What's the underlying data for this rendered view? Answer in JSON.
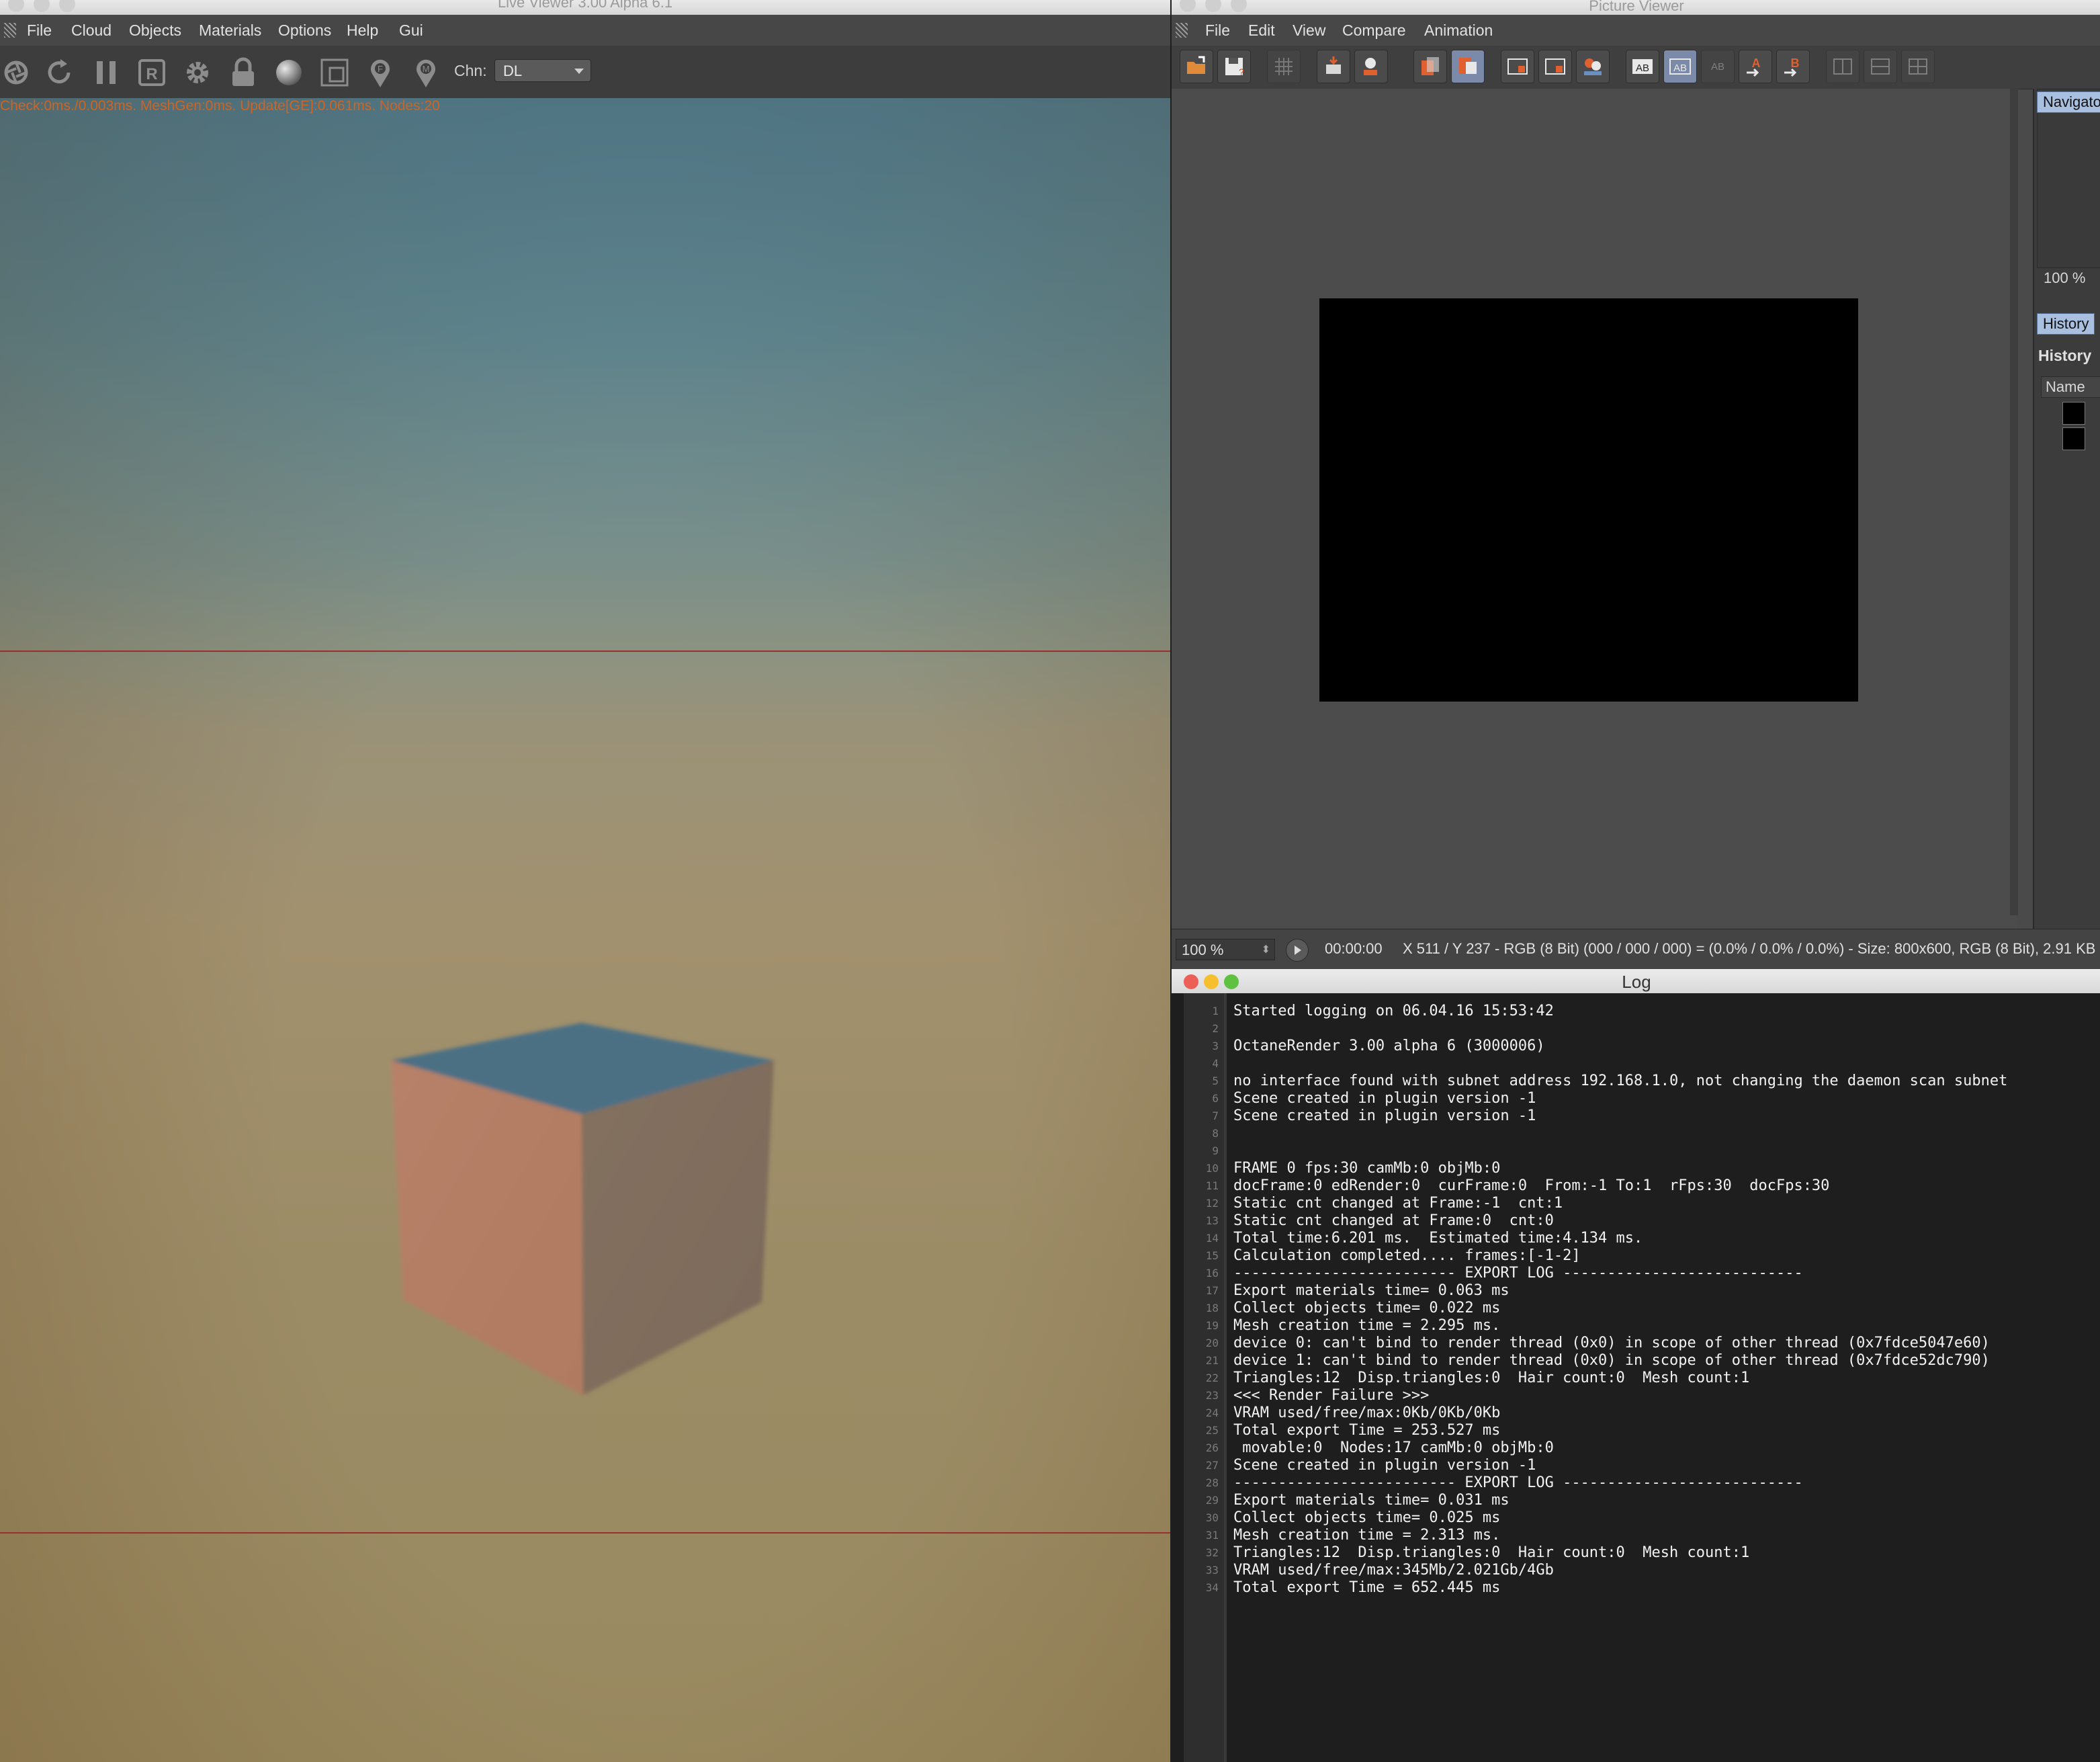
{
  "live_viewer": {
    "title": "Live Viewer 3.00 Alpha 6.1",
    "menu": [
      "File",
      "Cloud",
      "Objects",
      "Materials",
      "Options",
      "Help",
      "Gui"
    ],
    "toolbar": {
      "icons": [
        "aperture-icon",
        "refresh-icon",
        "pause-icon",
        "region-render-icon",
        "settings-gear-icon",
        "lock-icon",
        "material-sphere-icon",
        "viewport-frame-icon",
        "focus-pin-icon",
        "material-pick-pin-icon"
      ],
      "channel_label": "Chn:",
      "channel_value": "DL"
    },
    "stats_text": "Check:0ms./0.003ms. MeshGen:0ms. Update[GE]:0.061ms. Nodes:20",
    "scene": {
      "object": "cube",
      "colors": {
        "top": "#4b6f84",
        "left": "#b57c64",
        "right": "#826e60",
        "line": "#9a2f2f"
      }
    }
  },
  "picture_viewer": {
    "title": "Picture Viewer",
    "menu": [
      "File",
      "Edit",
      "View",
      "Compare",
      "Animation"
    ],
    "toolbar_icons": [
      "open-file-icon",
      "save-file-icon",
      "grid-icon",
      "layers-icon",
      "person-icon",
      "copy-icon",
      "stack-icon",
      "frame-icon",
      "frame-icon",
      "people-icon",
      "ab-compare-icon",
      "ab-compare-icon",
      "ab-compare-icon",
      "set-a-icon",
      "set-b-icon",
      "split-icon",
      "split-icon",
      "split-icon"
    ],
    "side_panel": {
      "navigator_tab": "Navigator",
      "zoom": "100 %",
      "history_tab": "History",
      "history_heading": "History",
      "name_column": "Name"
    },
    "status": {
      "zoom": "100 %",
      "time": "00:00:00",
      "info": "X 511 / Y 237 - RGB (8 Bit) (000 / 000 / 000) = (0.0% / 0.0% / 0.0%) - Size: 800x600, RGB (8 Bit), 2.91 KB"
    }
  },
  "log_window": {
    "title": "Log",
    "traffic_light_colors": [
      "#ec5f57",
      "#f5bf2f",
      "#5fc140"
    ],
    "lines": [
      "Started logging on 06.04.16 15:53:42",
      "",
      "OctaneRender 3.00 alpha 6 (3000006)",
      "",
      "no interface found with subnet address 192.168.1.0, not changing the daemon scan subnet",
      "Scene created in plugin version -1",
      "Scene created in plugin version -1",
      "",
      "",
      "FRAME 0 fps:30 camMb:0 objMb:0",
      "docFrame:0 edRender:0  curFrame:0  From:-1 To:1  rFps:30  docFps:30",
      "Static cnt changed at Frame:-1  cnt:1",
      "Static cnt changed at Frame:0  cnt:0",
      "Total time:6.201 ms.  Estimated time:4.134 ms.",
      "Calculation completed.... frames:[-1-2]",
      "------------------------- EXPORT LOG ---------------------------",
      "Export materials time= 0.063 ms",
      "Collect objects time= 0.022 ms",
      "Mesh creation time = 2.295 ms.",
      "device 0: can't bind to render thread (0x0) in scope of other thread (0x7fdce5047e60)",
      "device 1: can't bind to render thread (0x0) in scope of other thread (0x7fdce52dc790)",
      "Triangles:12  Disp.triangles:0  Hair count:0  Mesh count:1",
      "<<< Render Failure >>>",
      "VRAM used/free/max:0Kb/0Kb/0Kb",
      "Total export Time = 253.527 ms",
      " movable:0  Nodes:17 camMb:0 objMb:0",
      "Scene created in plugin version -1",
      "------------------------- EXPORT LOG ---------------------------",
      "Export materials time= 0.031 ms",
      "Collect objects time= 0.025 ms",
      "Mesh creation time = 2.313 ms.",
      "Triangles:12  Disp.triangles:0  Hair count:0  Mesh count:1",
      "VRAM used/free/max:345Mb/2.021Gb/4Gb",
      "Total export Time = 652.445 ms"
    ]
  }
}
